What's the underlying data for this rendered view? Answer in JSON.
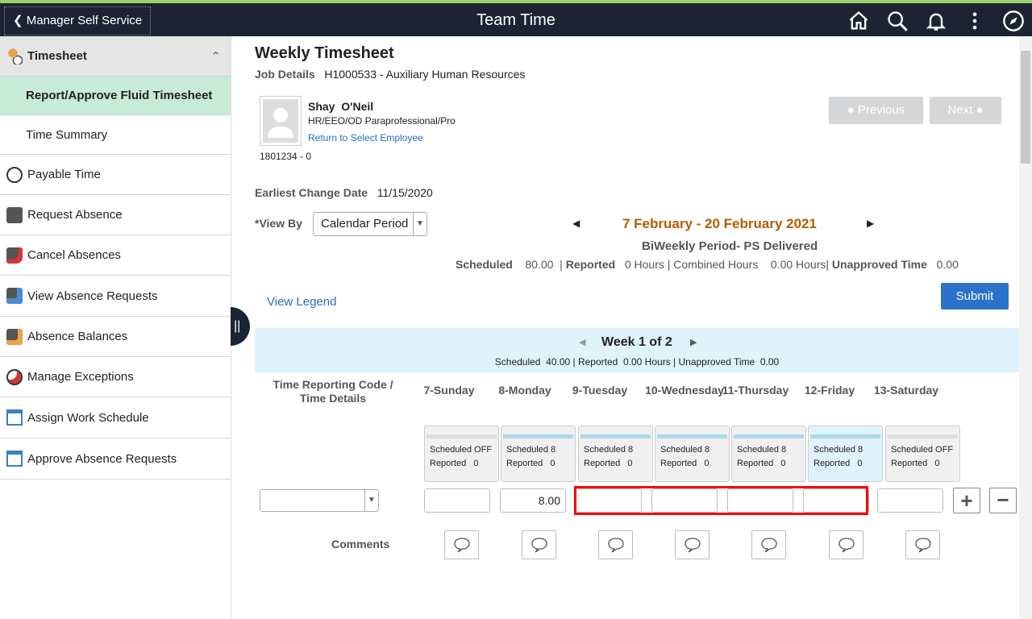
{
  "header": {
    "back_label": "Manager Self Service",
    "title": "Team Time"
  },
  "sidebar": {
    "section": "Timesheet",
    "items": [
      {
        "label": "Report/Approve Fluid Timesheet",
        "icon": "none"
      },
      {
        "label": "Time Summary",
        "icon": "none"
      },
      {
        "label": "Payable Time",
        "icon": "payable-time-icon"
      },
      {
        "label": "Request Absence",
        "icon": "briefcase-icon"
      },
      {
        "label": "Cancel Absences",
        "icon": "briefcase-cancel-icon"
      },
      {
        "label": "View Absence Requests",
        "icon": "briefcase-calendar-icon"
      },
      {
        "label": "Absence Balances",
        "icon": "briefcase-balance-icon"
      },
      {
        "label": "Manage Exceptions",
        "icon": "clock-alert-icon"
      },
      {
        "label": "Assign Work Schedule",
        "icon": "schedule-icon"
      },
      {
        "label": "Approve Absence Requests",
        "icon": "schedule-icon"
      }
    ]
  },
  "page": {
    "title": "Weekly Timesheet",
    "job_label": "Job Details",
    "job_value": "H1000533 - Auxiliary Human Resources",
    "employee": {
      "first": "Shay",
      "last": "O'Neil",
      "title": "HR/EEO/OD Paraprofessional/Pro",
      "return_link": "Return to Select Employee",
      "id": "1801234 - 0"
    },
    "previous": "Previous",
    "next": "Next",
    "earliest_label": "Earliest Change Date",
    "earliest_value": "11/15/2020",
    "viewby_label": "*View By",
    "viewby_value": "Calendar Period",
    "period": "7 February - 20 February 2021",
    "period_type": "BiWeekly Period- PS Delivered",
    "scheduled_label": "Scheduled",
    "scheduled_value": "80.00",
    "reported_label": "Reported",
    "reported_value": "0 Hours | Combined Hours",
    "combined_value": "0.00 Hours",
    "unapproved_label": "Unapproved Time",
    "unapproved_value": "0.00",
    "view_legend": "View Legend",
    "submit": "Submit",
    "week": {
      "title": "Week 1 of 2",
      "summary": "Scheduled  40.00 | Reported  0.00 Hours | Unapproved Time  0.00"
    },
    "trc_header": "Time Reporting Code / Time Details",
    "comments_label": "Comments",
    "days": [
      {
        "name": "7-Sunday",
        "scheduled": "Scheduled OFF",
        "reported": "Reported   0",
        "hours": ""
      },
      {
        "name": "8-Monday",
        "scheduled": "Scheduled 8",
        "reported": "Reported   0",
        "hours": "8.00"
      },
      {
        "name": "9-Tuesday",
        "scheduled": "Scheduled 8",
        "reported": "Reported   0",
        "hours": ""
      },
      {
        "name": "10-Wednesday",
        "scheduled": "Scheduled 8",
        "reported": "Reported   0",
        "hours": ""
      },
      {
        "name": "11-Thursday",
        "scheduled": "Scheduled 8",
        "reported": "Reported   0",
        "hours": ""
      },
      {
        "name": "12-Friday",
        "scheduled": "Scheduled 8",
        "reported": "Reported   0",
        "hours": ""
      },
      {
        "name": "13-Saturday",
        "scheduled": "Scheduled OFF",
        "reported": "Reported   0",
        "hours": ""
      }
    ]
  },
  "colors": {
    "accent": "#1f6fc5",
    "period": "#b35c00",
    "selected_nav": "#c8ead8",
    "week_band": "#dff3fb",
    "highlight": "#ff0000"
  }
}
